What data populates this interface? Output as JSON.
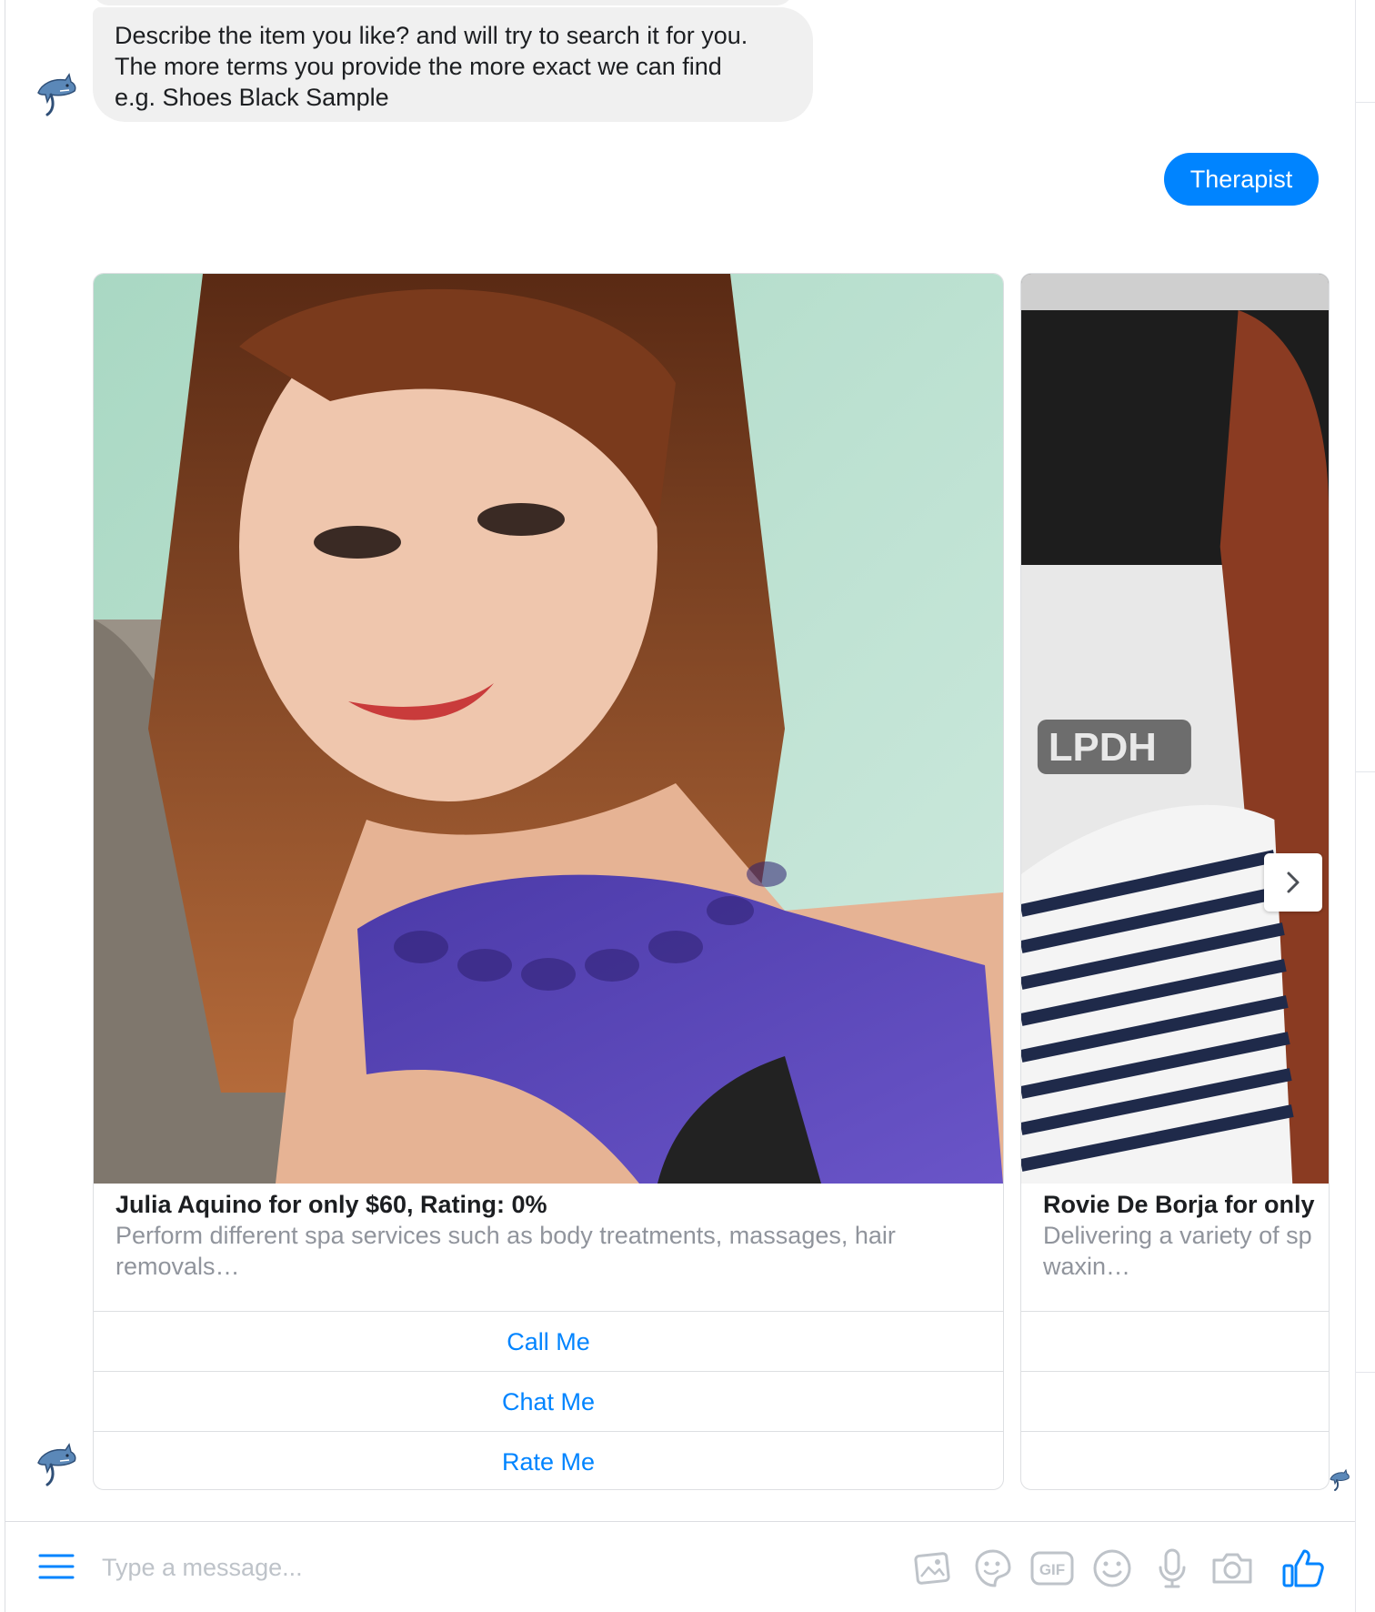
{
  "colors": {
    "accent": "#0084ff",
    "bot_bubble_bg": "#f0f0f0",
    "muted_text": "#90949c",
    "placeholder": "#bec3c9"
  },
  "messages": {
    "bot_prompt": {
      "line1": "Describe the item you like? and will try to search it for you.",
      "line2": "The more terms you provide the more exact we can find",
      "line3": "e.g. Shoes Black Sample"
    },
    "user_reply": "Therapist"
  },
  "carousel": {
    "cards": [
      {
        "title": "Julia Aquino for only $60, Rating: 0%",
        "subtitle": "Perform different spa services such as body treatments, massages, hair removals…",
        "buttons": [
          "Call Me",
          "Chat Me",
          "Rate Me"
        ]
      },
      {
        "title": "Rovie De Borja for only",
        "subtitle": "Delivering a variety of sp waxin…",
        "image_text": "LPDH",
        "buttons": [
          "",
          "",
          ""
        ]
      }
    ],
    "next_icon": "chevron-right-icon"
  },
  "composer": {
    "placeholder": "Type a message...",
    "icons": [
      "menu-icon",
      "image-icon",
      "sticker-icon",
      "gif-icon",
      "emoji-icon",
      "microphone-icon",
      "camera-icon",
      "thumbs-up-icon"
    ],
    "gif_label": "GIF"
  }
}
